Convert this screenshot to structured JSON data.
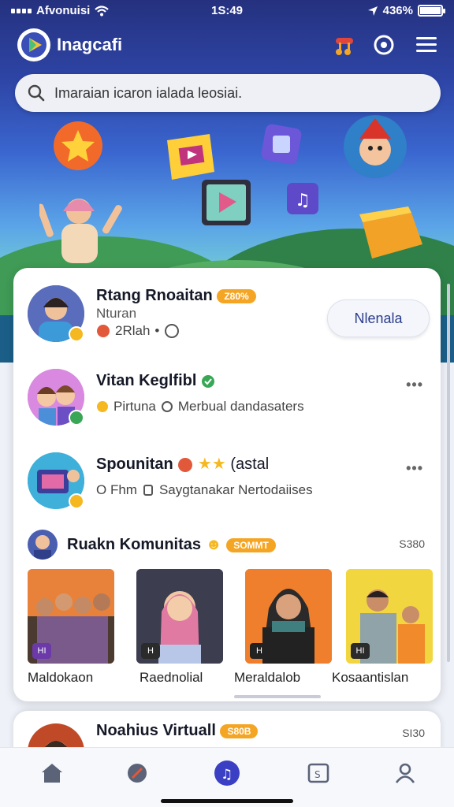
{
  "status_bar": {
    "carrier": "Afvonuisi",
    "time": "1S:49",
    "battery": "436%"
  },
  "app": {
    "title": "Inagcafi"
  },
  "search": {
    "placeholder": "Imaraian icaron ialada leosiai."
  },
  "card": {
    "rows": [
      {
        "title": "Rtang Rnoaitan",
        "badge": "Z80%",
        "subtitle": "Nturan",
        "meta_a": "2Rlah",
        "meta_b": "•",
        "action_label": "Nlenala"
      },
      {
        "title": "Vitan Keglfibl",
        "meta_a": "Pirtuna",
        "meta_b": "Merbual dandasaters",
        "more": "•••"
      },
      {
        "title": "Spounitan",
        "tag": "(astal",
        "meta_a": "O Fhm",
        "meta_b": "Saygtanakar Nertodaiises",
        "more": "•••"
      }
    ],
    "community": {
      "title": "Ruakn Komunitas",
      "badge": "SOMMT",
      "count": "S380",
      "items": [
        {
          "label": "Maldokaon",
          "tag": "HI"
        },
        {
          "label": "Raednolial",
          "tag": "H"
        },
        {
          "label": "Meraldalob",
          "tag": "H"
        },
        {
          "label": "Kosaantislan",
          "tag": "HI"
        }
      ]
    }
  },
  "card2": {
    "title": "Noahius Virtuall",
    "badge": "S80B",
    "count": "SI30"
  },
  "colors": {
    "accent": "#2b3d8c",
    "badge": "#f5a524",
    "header_top": "#25317f"
  },
  "icons": {
    "header": [
      "music-note-icon",
      "settings-icon",
      "menu-icon"
    ],
    "nav": [
      "home-icon",
      "explore-icon",
      "music-icon",
      "chat-icon",
      "profile-icon"
    ]
  }
}
